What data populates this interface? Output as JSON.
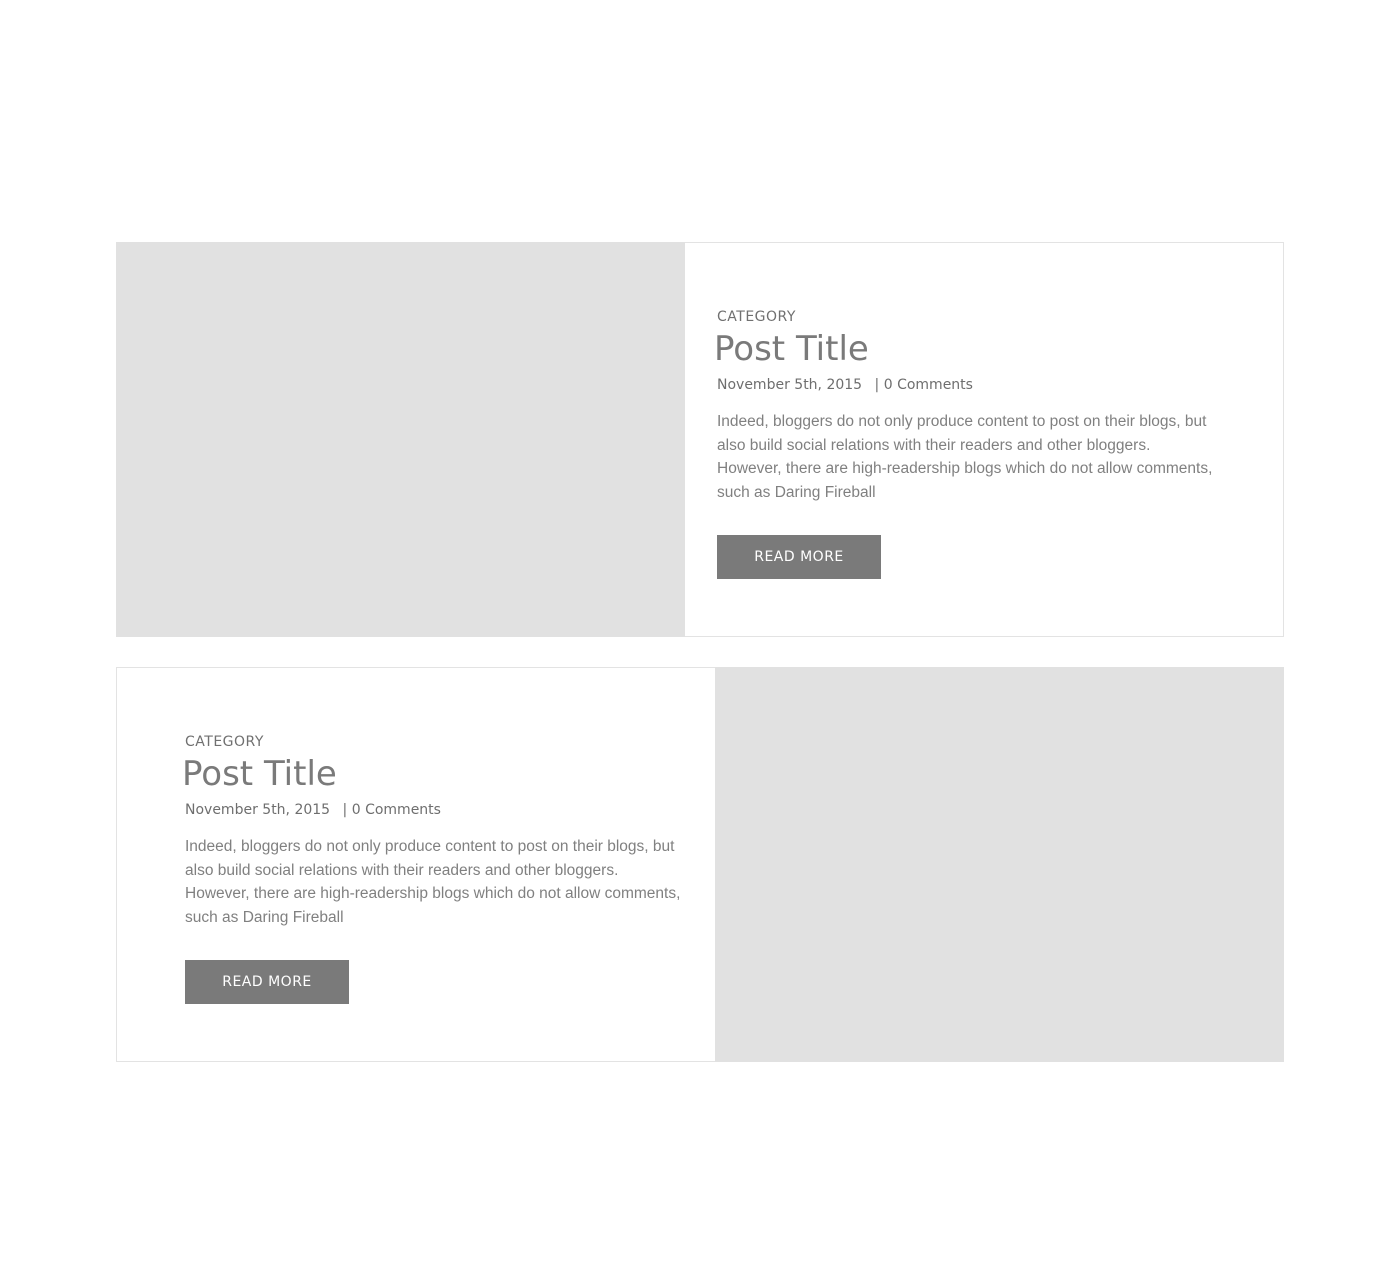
{
  "posts": [
    {
      "category": "CATEGORY",
      "title": "Post Title",
      "date": "November 5th, 2015",
      "separator": "|",
      "comments": "0 Comments",
      "excerpt": "Indeed, bloggers do not only produce content to post on their blogs, but also build social relations with their readers and other bloggers. However, there are high-readership blogs which do not allow comments, such as Daring Fireball",
      "button_label": "READ MORE"
    },
    {
      "category": "CATEGORY",
      "title": "Post Title",
      "date": "November 5th, 2015",
      "separator": "|",
      "comments": "0 Comments",
      "excerpt": "Indeed, bloggers do not only produce content to post on their blogs, but also build social relations with their readers and other bloggers. However, there are high-readership blogs which do not allow comments, such as Daring Fireball",
      "button_label": "READ MORE"
    }
  ],
  "colors": {
    "placeholder": "#e1e1e1",
    "button": "#7a7a7a",
    "text": "#707070",
    "border": "#e3e3e3"
  }
}
